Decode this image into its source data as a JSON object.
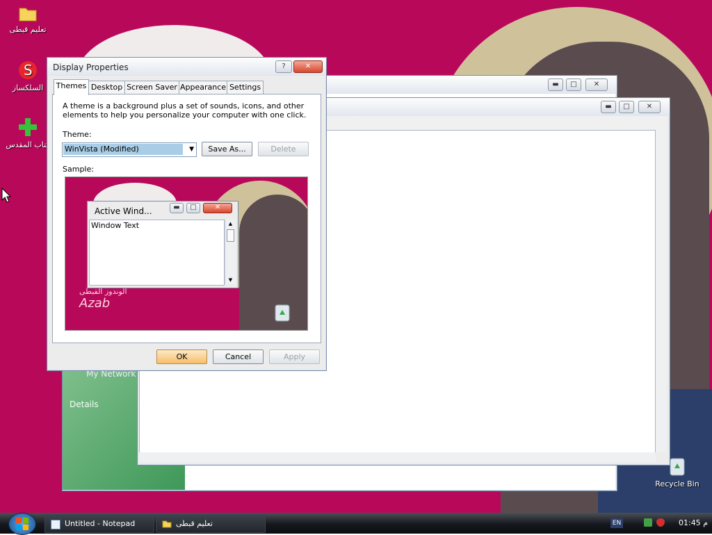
{
  "desktop_icons": [
    {
      "label": "تعليم قبطى",
      "icon": "folder-icon"
    },
    {
      "label": "السلكساز",
      "icon": "s-app-shortcut-icon"
    },
    {
      "label": "كتاب المقدس",
      "icon": "green-cross-shortcut-icon"
    },
    {
      "label": "Recycle Bin",
      "icon": "recycle-bin-icon"
    }
  ],
  "display_properties": {
    "title": "Display Properties",
    "help_glyph": "?",
    "close_glyph": "✕",
    "tabs": [
      "Themes",
      "Desktop",
      "Screen Saver",
      "Appearance",
      "Settings"
    ],
    "active_tab": "Themes",
    "description": "A theme is a background plus a set of sounds, icons, and other elements to help you personalize your computer with one click.",
    "theme_label": "Theme:",
    "theme_value": "WinVista (Modified)",
    "save_as": "Save As...",
    "delete": "Delete",
    "sample_label": "Sample:",
    "sample": {
      "window_title": "Active Wind...",
      "window_text": "Window Text",
      "logo_text": "Azab",
      "logo_arabic": "الوندوز القبطى"
    },
    "ok": "OK",
    "cancel": "Cancel",
    "apply": "Apply"
  },
  "behind_window": {
    "sidebar_link": "My Network P",
    "details": "Details"
  },
  "window_buttons": {
    "minimize": "▬",
    "maximize": "□",
    "close": "✕"
  },
  "taskbar": {
    "start_icon": "windows-logo-icon",
    "items": [
      "Untitled - Notepad",
      "تعليم قبطى"
    ],
    "language": "EN",
    "clock": "01:45 م"
  },
  "colors": {
    "desktop": "#b8085a",
    "taskbar": "#15181d",
    "accent": "#a9cde6"
  }
}
